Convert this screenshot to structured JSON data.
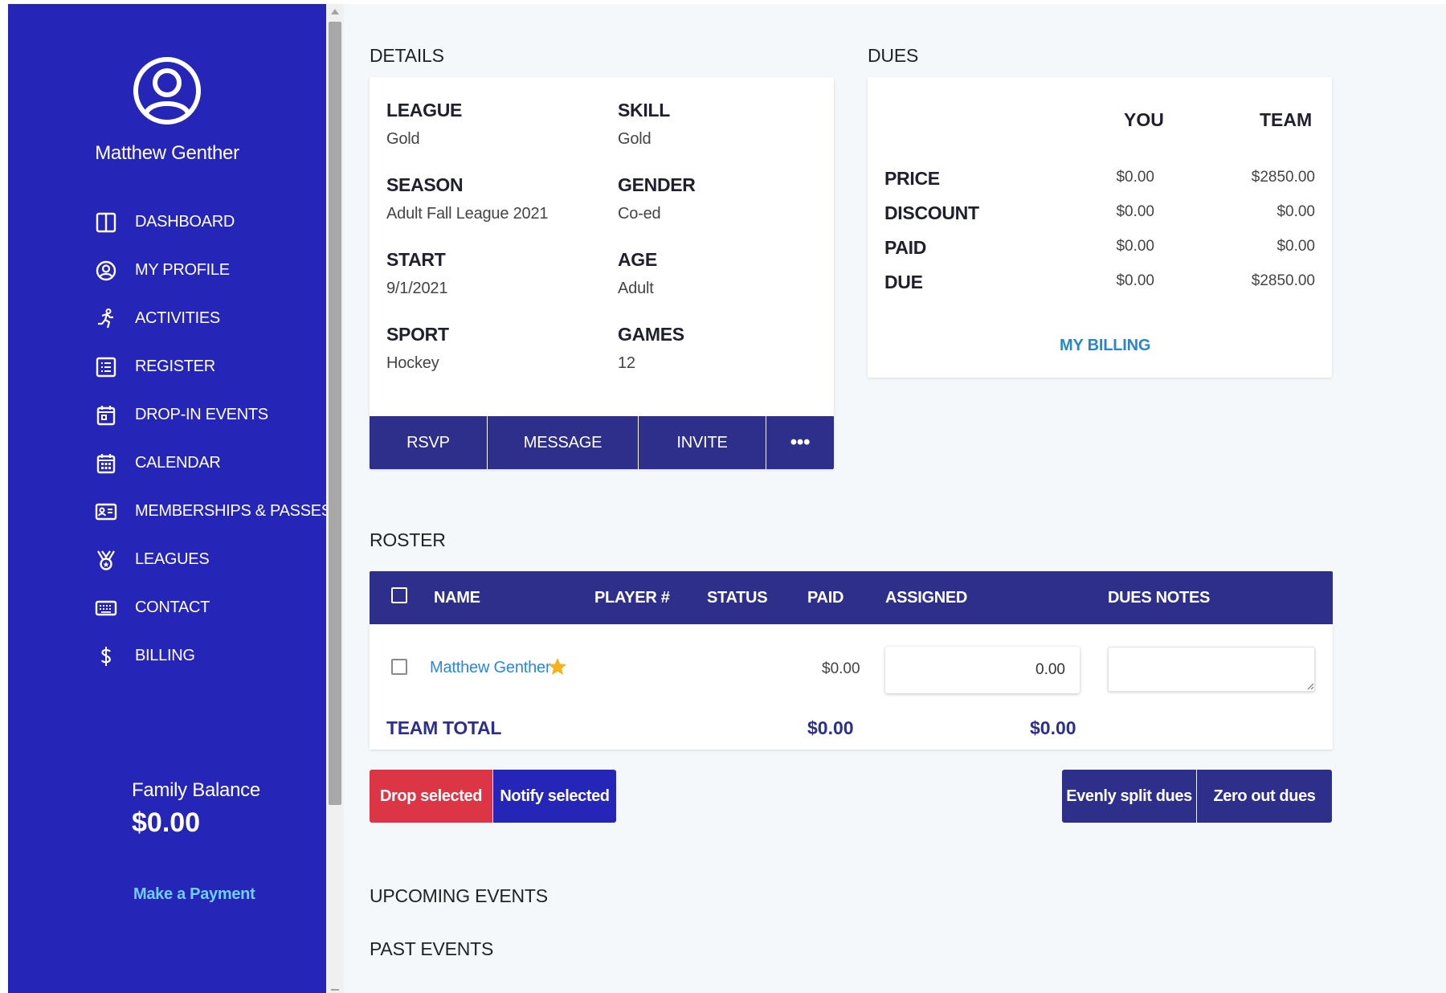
{
  "user": {
    "name": "Matthew Genther",
    "avatar_icon": "user-circle-icon"
  },
  "nav": [
    {
      "label": "DASHBOARD",
      "icon": "dashboard-columns-icon"
    },
    {
      "label": "MY PROFILE",
      "icon": "profile-circle-icon"
    },
    {
      "label": "ACTIVITIES",
      "icon": "running-person-icon"
    },
    {
      "label": "REGISTER",
      "icon": "list-form-icon"
    },
    {
      "label": "DROP-IN EVENTS",
      "icon": "calendar-day-icon"
    },
    {
      "label": "CALENDAR",
      "icon": "calendar-grid-icon"
    },
    {
      "label": "MEMBERSHIPS & PASSES",
      "icon": "id-card-icon"
    },
    {
      "label": "LEAGUES",
      "icon": "medal-icon"
    },
    {
      "label": "CONTACT",
      "icon": "keyboard-icon"
    },
    {
      "label": "BILLING",
      "icon": "dollar-icon"
    }
  ],
  "family_balance": {
    "label": "Family Balance",
    "value": "$0.00",
    "payment_link": "Make a Payment"
  },
  "details": {
    "title": "DETAILS",
    "fields": [
      {
        "label": "LEAGUE",
        "value": "Gold"
      },
      {
        "label": "SKILL",
        "value": "Gold"
      },
      {
        "label": "SEASON",
        "value": "Adult Fall League 2021"
      },
      {
        "label": "GENDER",
        "value": "Co-ed"
      },
      {
        "label": "START",
        "value": "9/1/2021"
      },
      {
        "label": "AGE",
        "value": "Adult"
      },
      {
        "label": "SPORT",
        "value": "Hockey"
      },
      {
        "label": "GAMES",
        "value": "12"
      }
    ],
    "buttons": {
      "rsvp": "RSVP",
      "message": "MESSAGE",
      "invite": "INVITE",
      "more": "•••"
    }
  },
  "dues": {
    "title": "DUES",
    "col_you": "YOU",
    "col_team": "TEAM",
    "rows": [
      {
        "label": "PRICE",
        "you": "$0.00",
        "team": "$2850.00"
      },
      {
        "label": "DISCOUNT",
        "you": "$0.00",
        "team": "$0.00"
      },
      {
        "label": "PAID",
        "you": "$0.00",
        "team": "$0.00"
      },
      {
        "label": "DUE",
        "you": "$0.00",
        "team": "$2850.00"
      }
    ],
    "billing_link": "MY BILLING"
  },
  "roster": {
    "title": "ROSTER",
    "headers": {
      "name": "NAME",
      "player_no": "PLAYER #",
      "status": "STATUS",
      "paid": "PAID",
      "assigned": "ASSIGNED",
      "dues_notes": "DUES NOTES"
    },
    "rows": [
      {
        "name": "Matthew Genther",
        "captain_icon": "star-icon",
        "paid": "$0.00",
        "assigned": "0.00",
        "notes": ""
      }
    ],
    "total": {
      "label": "TEAM TOTAL",
      "paid": "$0.00",
      "assigned": "$0.00"
    },
    "actions": {
      "drop": "Drop selected",
      "notify": "Notify selected",
      "split": "Evenly split dues",
      "zero": "Zero out dues"
    }
  },
  "upcoming_title": "UPCOMING EVENTS",
  "past_title": "PAST EVENTS",
  "colors": {
    "sidebar": "#2525b8",
    "bar": "#2d2f8a",
    "drop": "#dc3545",
    "link": "#2a86e0"
  }
}
